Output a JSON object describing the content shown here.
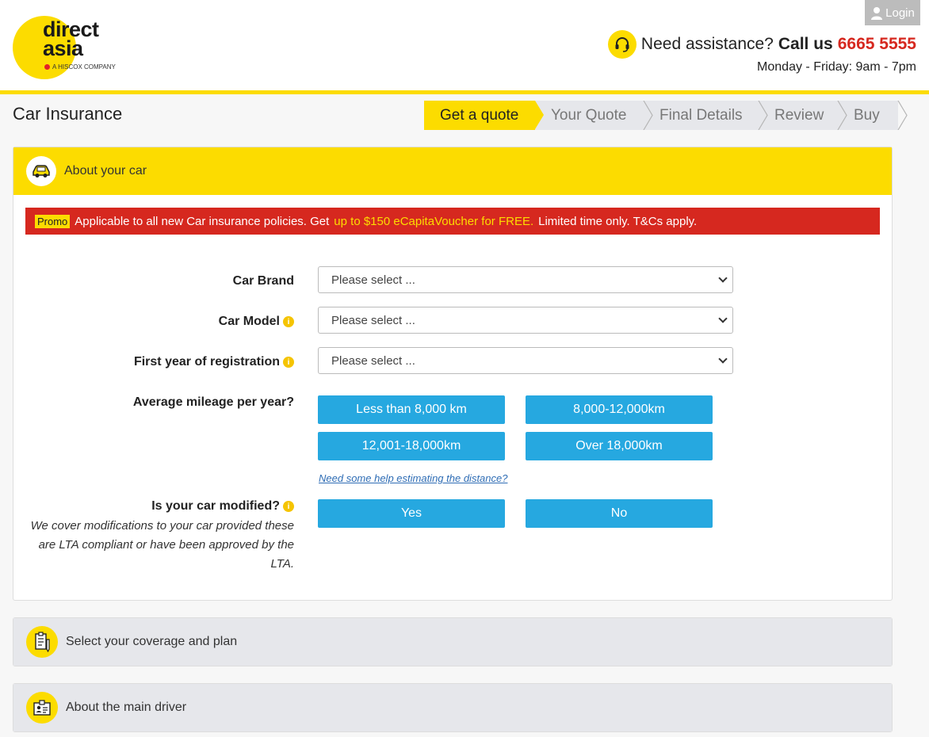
{
  "header": {
    "logo_word1": "direct",
    "logo_word2": "asia",
    "logo_sub": "A HISCOX COMPANY",
    "login_label": "Login",
    "assist_question": "Need assistance?",
    "assist_call": "Call us",
    "assist_phone": "6665 5555",
    "hours": "Monday - Friday: 9am - 7pm"
  },
  "page": {
    "title": "Car Insurance",
    "steps": [
      {
        "label": "Get a quote",
        "active": true
      },
      {
        "label": "Your Quote",
        "active": false
      },
      {
        "label": "Final Details",
        "active": false
      },
      {
        "label": "Review",
        "active": false
      },
      {
        "label": "Buy",
        "active": false
      }
    ]
  },
  "about_car": {
    "heading": "About your car",
    "promo_tag": "Promo",
    "promo_text_1": "Applicable to all new Car insurance policies. Get",
    "promo_highlight": "up to $150 eCapitaVoucher for FREE.",
    "promo_text_2": "Limited time only. T&Cs apply.",
    "car_brand_label": "Car Brand",
    "car_brand_value": "Please select ...",
    "car_model_label": "Car Model",
    "car_model_value": "Please select ...",
    "first_year_label": "First year of registration",
    "first_year_value": "Please select ...",
    "mileage_label": "Average mileage per year?",
    "mileage_options": [
      "Less than 8,000 km",
      "8,000-12,000km",
      "12,001-18,000km",
      "Over 18,000km"
    ],
    "mileage_help": "Need some help estimating the distance?",
    "modified_label": "Is your car modified?",
    "modified_note": "We cover modifications to your car provided these are LTA compliant or have been approved by the LTA.",
    "modified_yes": "Yes",
    "modified_no": "No",
    "info_glyph": "i"
  },
  "coverage": {
    "heading": "Select your coverage and plan"
  },
  "driver": {
    "heading": "About the main driver"
  },
  "colors": {
    "brand_yellow": "#fcdc00",
    "promo_red": "#d6281f",
    "button_blue": "#26a8e0",
    "link_blue": "#2f6db5"
  },
  "icons": [
    "user-icon",
    "headset-icon",
    "car-icon",
    "info-icon",
    "chevron-down-icon",
    "checklist-icon",
    "id-card-icon"
  ]
}
